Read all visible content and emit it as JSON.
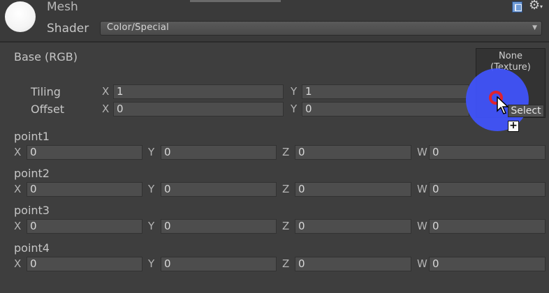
{
  "header": {
    "mesh_label": "Mesh",
    "shader_label": "Shader",
    "shader_value": "Color/Special"
  },
  "icons": {
    "help": "help-book-icon",
    "settings": "gear-icon"
  },
  "texture": {
    "label": "Base (RGB)",
    "preview_text": "None\n(Texture)",
    "select_label": "Select",
    "tiling_label": "Tiling",
    "offset_label": "Offset",
    "tiling": {
      "x": "1",
      "y": "1"
    },
    "offset": {
      "x": "0",
      "y": "0"
    }
  },
  "axes": {
    "x": "X",
    "y": "Y",
    "z": "Z",
    "w": "W"
  },
  "points": [
    {
      "label": "point1",
      "x": "0",
      "y": "0",
      "z": "0",
      "w": "0"
    },
    {
      "label": "point2",
      "x": "0",
      "y": "0",
      "z": "0",
      "w": "0"
    },
    {
      "label": "point3",
      "x": "0",
      "y": "0",
      "z": "0",
      "w": "0"
    },
    {
      "label": "point4",
      "x": "0",
      "y": "0",
      "z": "0",
      "w": "0"
    }
  ],
  "colors": {
    "panel": "#3e3e3e",
    "field": "#4d4d4d",
    "highlight": "#4054ff",
    "ring": "#e0222e"
  }
}
